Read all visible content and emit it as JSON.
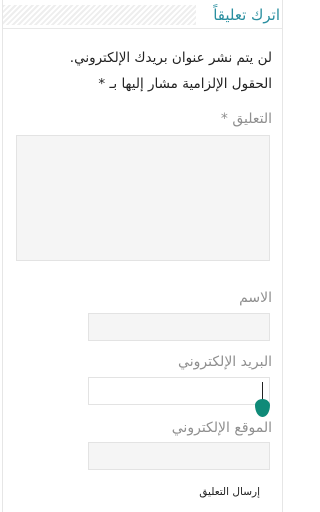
{
  "form": {
    "title": "اترك تعليقاً",
    "notice_email": "لن يتم نشر عنوان بريدك الإلكتروني.",
    "notice_required": "الحقول الإلزامية مشار إليها بـ",
    "required_marker": "*",
    "comment_label": "التعليق",
    "name_label": "الاسم",
    "email_label": "البريد الإلكتروني",
    "url_label": "الموقع الإلكتروني",
    "submit_label": "إرسال التعليق"
  },
  "colors": {
    "title": "#2a8fa0",
    "caret_handle": "#0f8a78",
    "field_background": "#f5f5f5",
    "label_text": "#8f8f8f"
  },
  "icons": {
    "caret_handle": "text-cursor-handle-icon"
  }
}
